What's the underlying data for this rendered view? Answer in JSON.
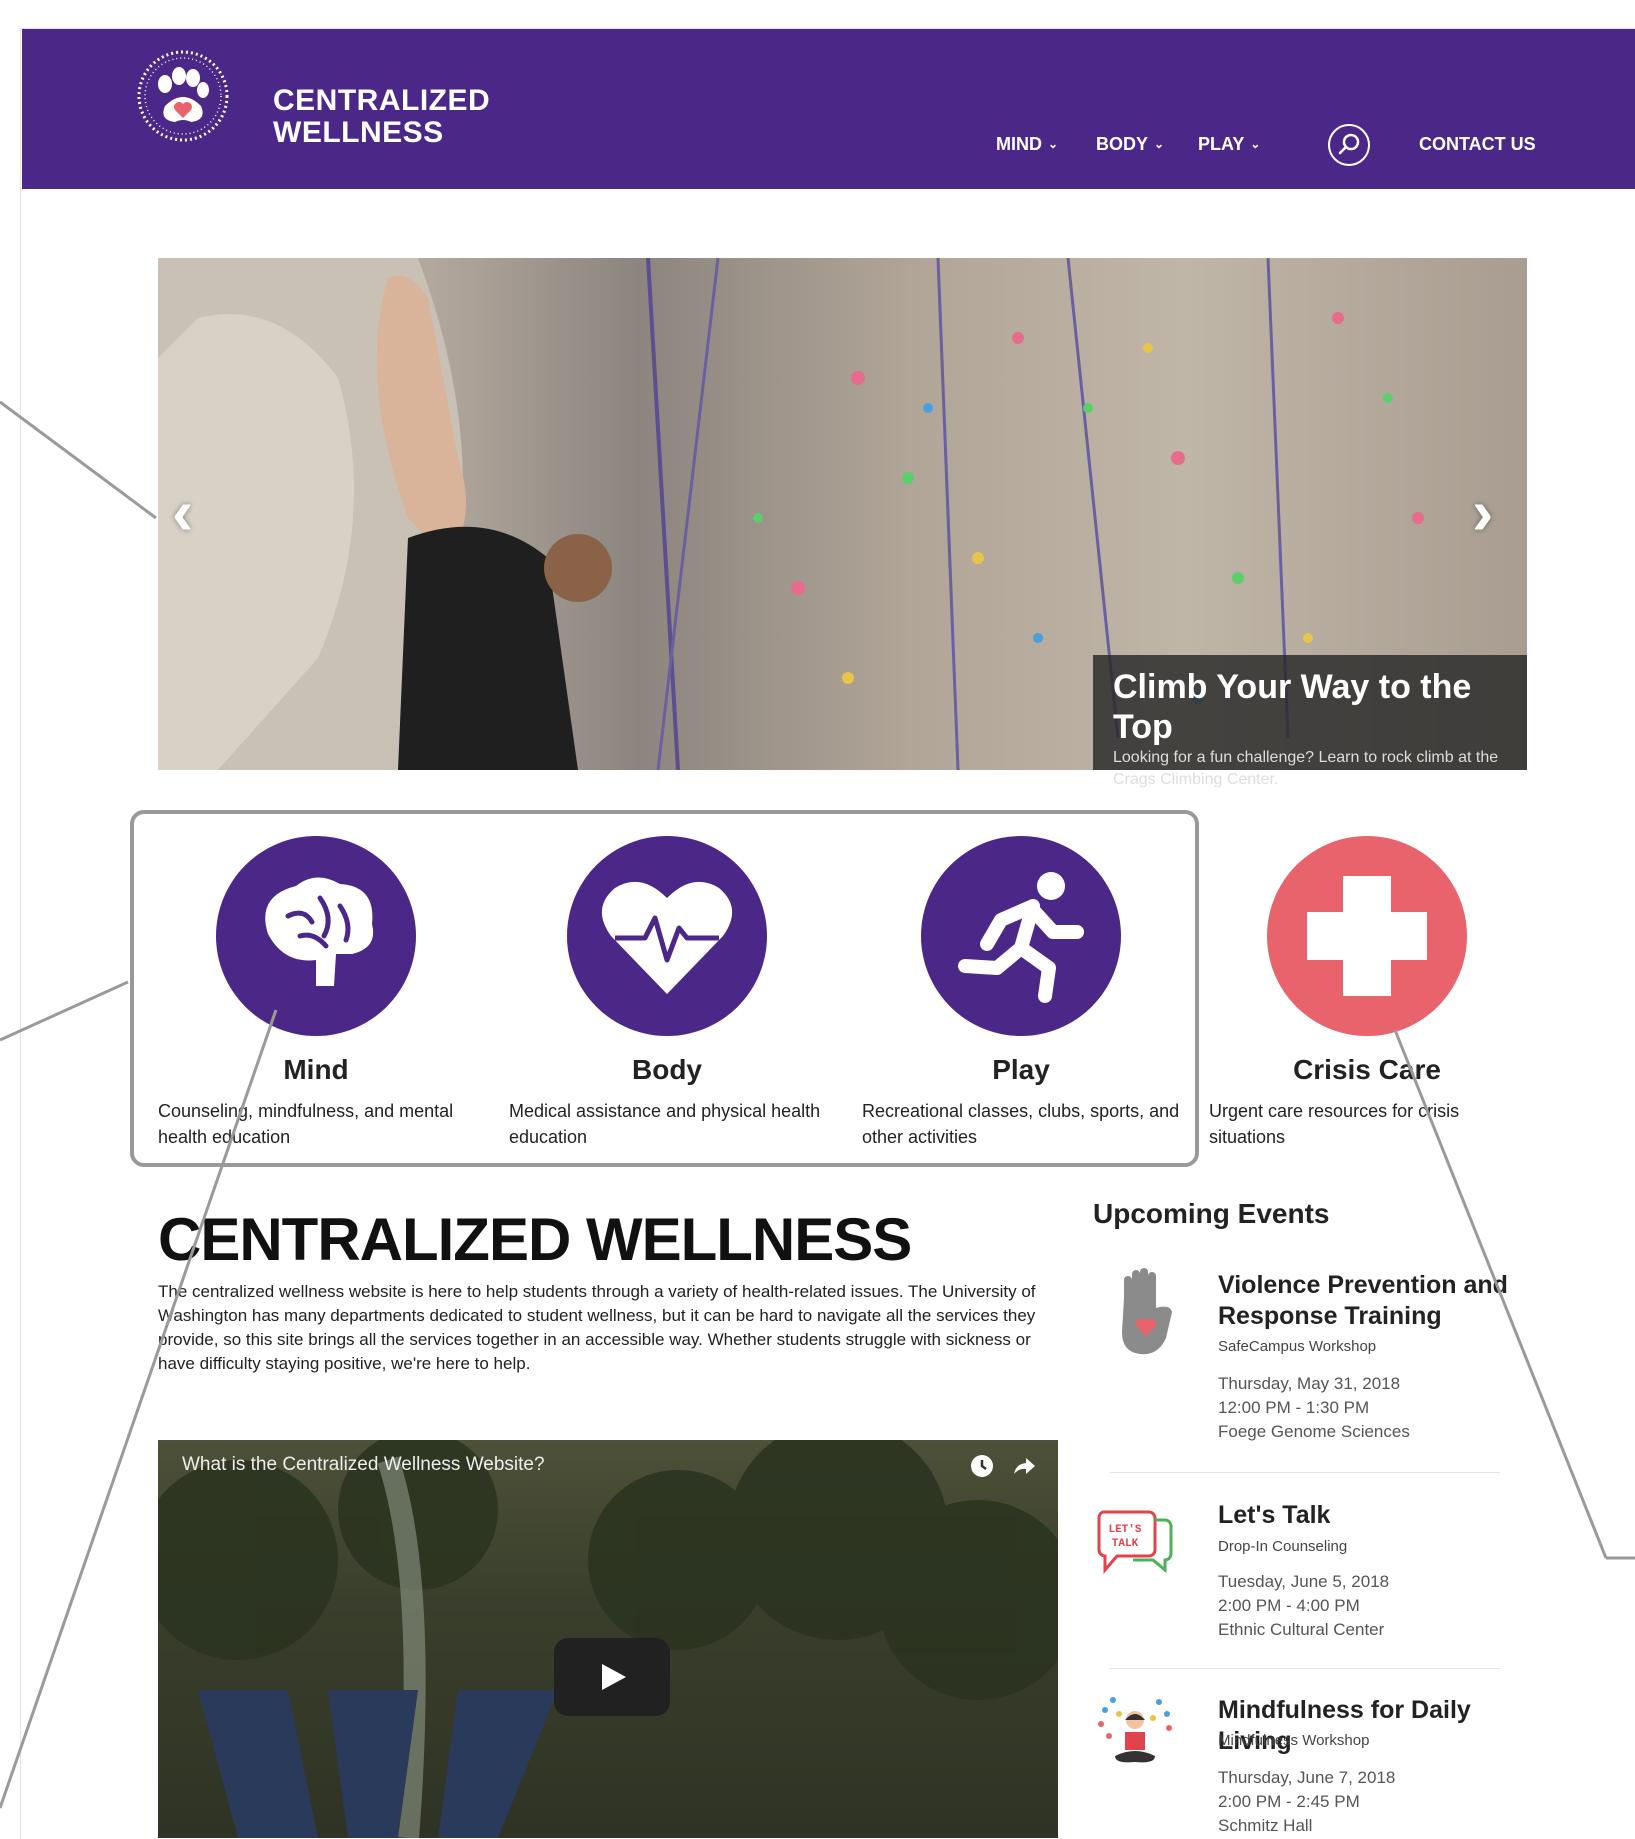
{
  "brand": {
    "line1": "CENTRALIZED",
    "line2": "WELLNESS"
  },
  "nav": {
    "items": [
      {
        "label": "MIND",
        "chevron": "⌄"
      },
      {
        "label": "BODY",
        "chevron": "⌄"
      },
      {
        "label": "PLAY",
        "chevron": "⌄"
      }
    ],
    "contact": "CONTACT US"
  },
  "hero": {
    "prev": "‹",
    "next": "›",
    "caption_title": "Climb Your Way to the Top",
    "caption_text": "Looking for a fun challenge? Learn to rock climb at the Crags Climbing Center."
  },
  "categories": [
    {
      "title": "Mind",
      "desc": "Counseling, mindfulness, and mental health education",
      "icon": "brain-icon"
    },
    {
      "title": "Body",
      "desc": "Medical assistance and physical health education",
      "icon": "heart-pulse-icon"
    },
    {
      "title": "Play",
      "desc": "Recreational classes, clubs, sports, and other activities",
      "icon": "runner-icon"
    },
    {
      "title": "Crisis Care",
      "desc": "Urgent care resources for crisis situations",
      "icon": "cross-icon"
    }
  ],
  "main": {
    "title": "CENTRALIZED WELLNESS",
    "text": "The centralized wellness website is here to help students through a variety of health-related issues. The University of Washington has many departments dedicated to student wellness, but it can be hard to navigate all the services they provide, so this site brings all the services together in an accessible way. Whether students struggle with sickness or have difficulty staying positive, we're here to help.",
    "video_title": "What is the Centralized Wellness Website?"
  },
  "events": {
    "title": "Upcoming Events",
    "items": [
      {
        "title": "Violence Prevention and Response Training",
        "subtitle": "SafeCampus Workshop",
        "date": "Thursday, May 31, 2018",
        "time": "12:00 PM - 1:30 PM",
        "location": "Foege Genome Sciences",
        "icon": "hand-heart-icon"
      },
      {
        "title": "Let's Talk",
        "subtitle": "Drop-In Counseling",
        "date": "Tuesday, June 5, 2018",
        "time": "2:00 PM - 4:00 PM",
        "location": "Ethnic Cultural Center",
        "icon": "lets-talk-icon",
        "icon_text_1": "LET'S",
        "icon_text_2": "TALK"
      },
      {
        "title": "Mindfulness for Daily Living",
        "subtitle": "Mindfulness Workshop",
        "date": "Thursday, June 7, 2018",
        "time": "2:00 PM - 2:45 PM",
        "location": "Schmitz Hall",
        "icon": "meditation-icon"
      }
    ]
  },
  "colors": {
    "purple": "#4b2787",
    "crisis": "#e8636b"
  }
}
